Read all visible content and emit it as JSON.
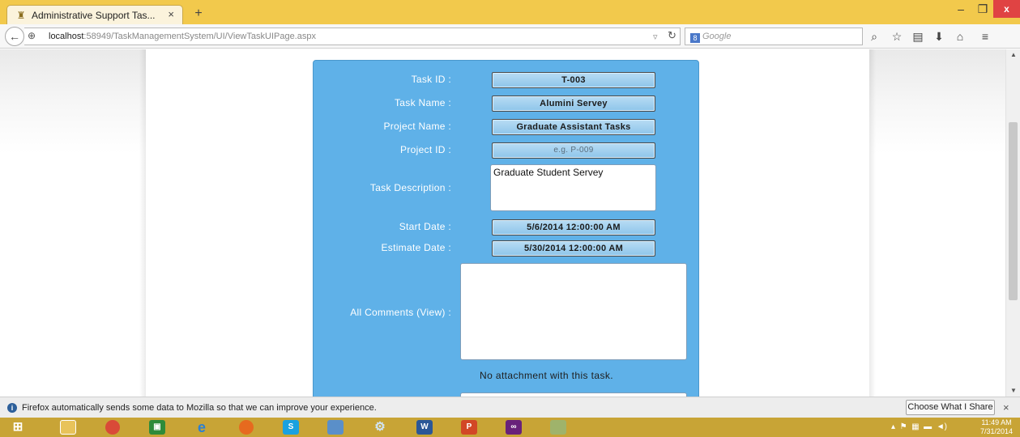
{
  "browser": {
    "tab_title": "Administrative Support Tas...",
    "tab_close": "×",
    "new_tab": "+",
    "url_host": "localhost",
    "url_path": ":58949/TaskManagementSystem/UI/ViewTaskUIPage.aspx",
    "search_engine_badge": "8",
    "search_placeholder": "Google",
    "window_min": "–",
    "window_max": "❐",
    "window_close": "x"
  },
  "form": {
    "task_id": {
      "label": "Task ID :",
      "value": "T-003"
    },
    "task_name": {
      "label": "Task Name :",
      "value": "Alumini Servey"
    },
    "project_name": {
      "label": "Project Name :",
      "value": "Graduate Assistant Tasks"
    },
    "project_id": {
      "label": "Project ID :",
      "placeholder": "e.g. P-009"
    },
    "task_description": {
      "label": "Task Description :",
      "value": "Graduate Student Servey"
    },
    "start_date": {
      "label": "Start Date :",
      "value": "5/6/2014 12:00:00 AM"
    },
    "estimate_date": {
      "label": "Estimate Date :",
      "value": "5/30/2014 12:00:00 AM"
    },
    "all_comments": {
      "label": "All Comments (View) :",
      "value": ""
    },
    "attachment_note": "No attachment with this task."
  },
  "notification": {
    "message": "Firefox automatically sends some data to Mozilla so that we can improve your experience.",
    "button_label": "Choose What I Share",
    "close": "×"
  },
  "taskbar": {
    "apps": [
      "start",
      "file-explorer",
      "chrome",
      "store",
      "internet-explorer",
      "firefox",
      "skype",
      "remote-desktop",
      "settings",
      "word",
      "powerpoint",
      "visual-studio",
      "paint"
    ],
    "clock_time": "11:49 AM",
    "clock_date": "7/31/2014"
  },
  "colors": {
    "panel": "#5fb1e8",
    "tabbar": "#f2c94c",
    "taskbar": "#c8a436"
  }
}
